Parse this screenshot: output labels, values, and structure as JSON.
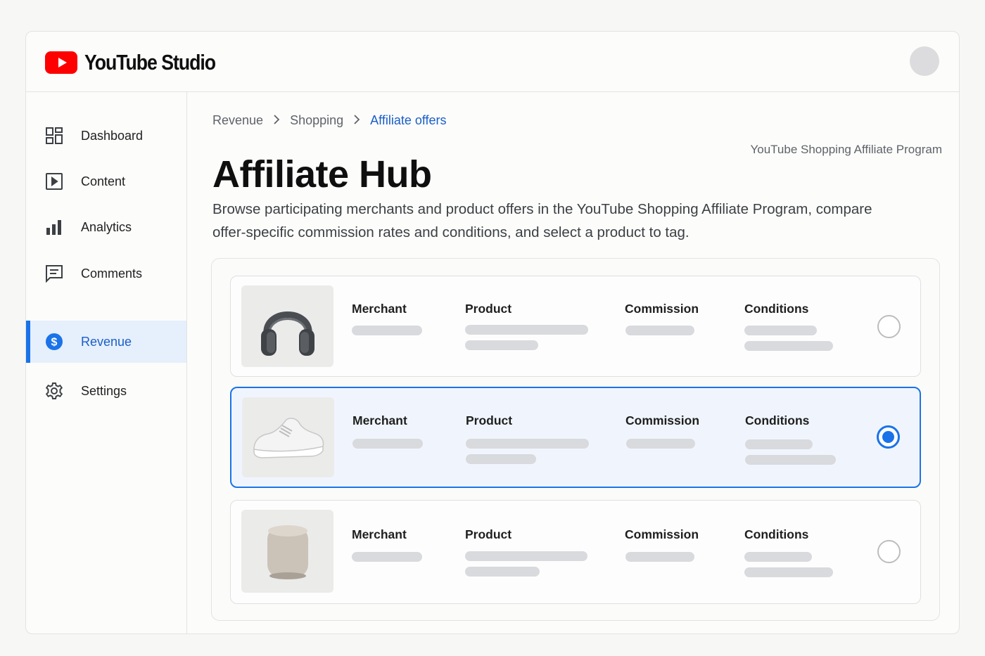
{
  "app": {
    "title": "YouTube Studio",
    "logo_icon": "youtube-play-icon",
    "brand_color": "#ff0000",
    "accent_color": "#1a73e8"
  },
  "sidebar": {
    "items": [
      {
        "label": "Dashboard",
        "icon": "dashboard-grid-icon",
        "active": false
      },
      {
        "label": "Content",
        "icon": "play-square-icon",
        "active": false
      },
      {
        "label": "Analytics",
        "icon": "bar-chart-icon",
        "active": false
      },
      {
        "label": "Comments",
        "icon": "comment-icon",
        "active": false
      },
      {
        "label": "Revenue",
        "icon": "dollar-circle-icon",
        "active": true
      },
      {
        "label": "Settings",
        "icon": "gear-icon",
        "active": false
      }
    ]
  },
  "breadcrumb": [
    {
      "label": "Revenue"
    },
    {
      "label": "Shopping"
    },
    {
      "label": "Affiliate offers"
    }
  ],
  "program_label": "YouTube Shopping Affiliate Program",
  "page": {
    "title": "Affiliate Hub",
    "description": "Browse participating merchants and product offers in the YouTube Shopping Affiliate Program, compare offer-specific commission rates and conditions, and select a product to tag."
  },
  "offers": {
    "column_labels": {
      "merchant": "Merchant",
      "product": "Product",
      "commission": "Commission",
      "conditions": "Conditions"
    },
    "items": [
      {
        "thumbnail": "headphones-image",
        "selected": false
      },
      {
        "thumbnail": "sneaker-image",
        "selected": true
      },
      {
        "thumbnail": "speaker-image",
        "selected": false
      }
    ]
  }
}
